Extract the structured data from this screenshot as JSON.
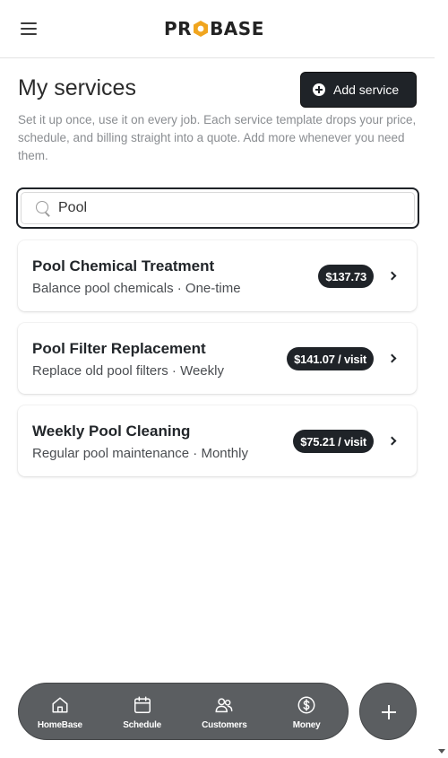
{
  "header": {
    "logo_text_left": "PR",
    "logo_text_right": "BASE",
    "brand_accent": "#f0a51f"
  },
  "page": {
    "title": "My services",
    "add_button_label": "Add service",
    "intro": "Set it up once, use it on every job. Each service template drops your price, schedule, and billing straight into a quote. Add more whenever you need them."
  },
  "search": {
    "value": "Pool",
    "placeholder": ""
  },
  "services": [
    {
      "name": "Pool Chemical Treatment",
      "description": "Balance pool chemicals · One-time",
      "price": "$137.73"
    },
    {
      "name": "Pool Filter Replacement",
      "description": "Replace old pool filters · Weekly",
      "price": "$141.07 / visit"
    },
    {
      "name": "Weekly Pool Cleaning",
      "description": "Regular pool maintenance · Monthly",
      "price": "$75.21 / visit"
    }
  ],
  "bottom_nav": {
    "items": [
      {
        "label": "HomeBase",
        "icon": "home-icon"
      },
      {
        "label": "Schedule",
        "icon": "calendar-icon"
      },
      {
        "label": "Customers",
        "icon": "users-icon"
      },
      {
        "label": "Money",
        "icon": "dollar-icon"
      }
    ],
    "fab_icon": "plus-icon"
  },
  "colors": {
    "primary_dark": "#1f2328",
    "nav_background": "#5b5e61"
  }
}
